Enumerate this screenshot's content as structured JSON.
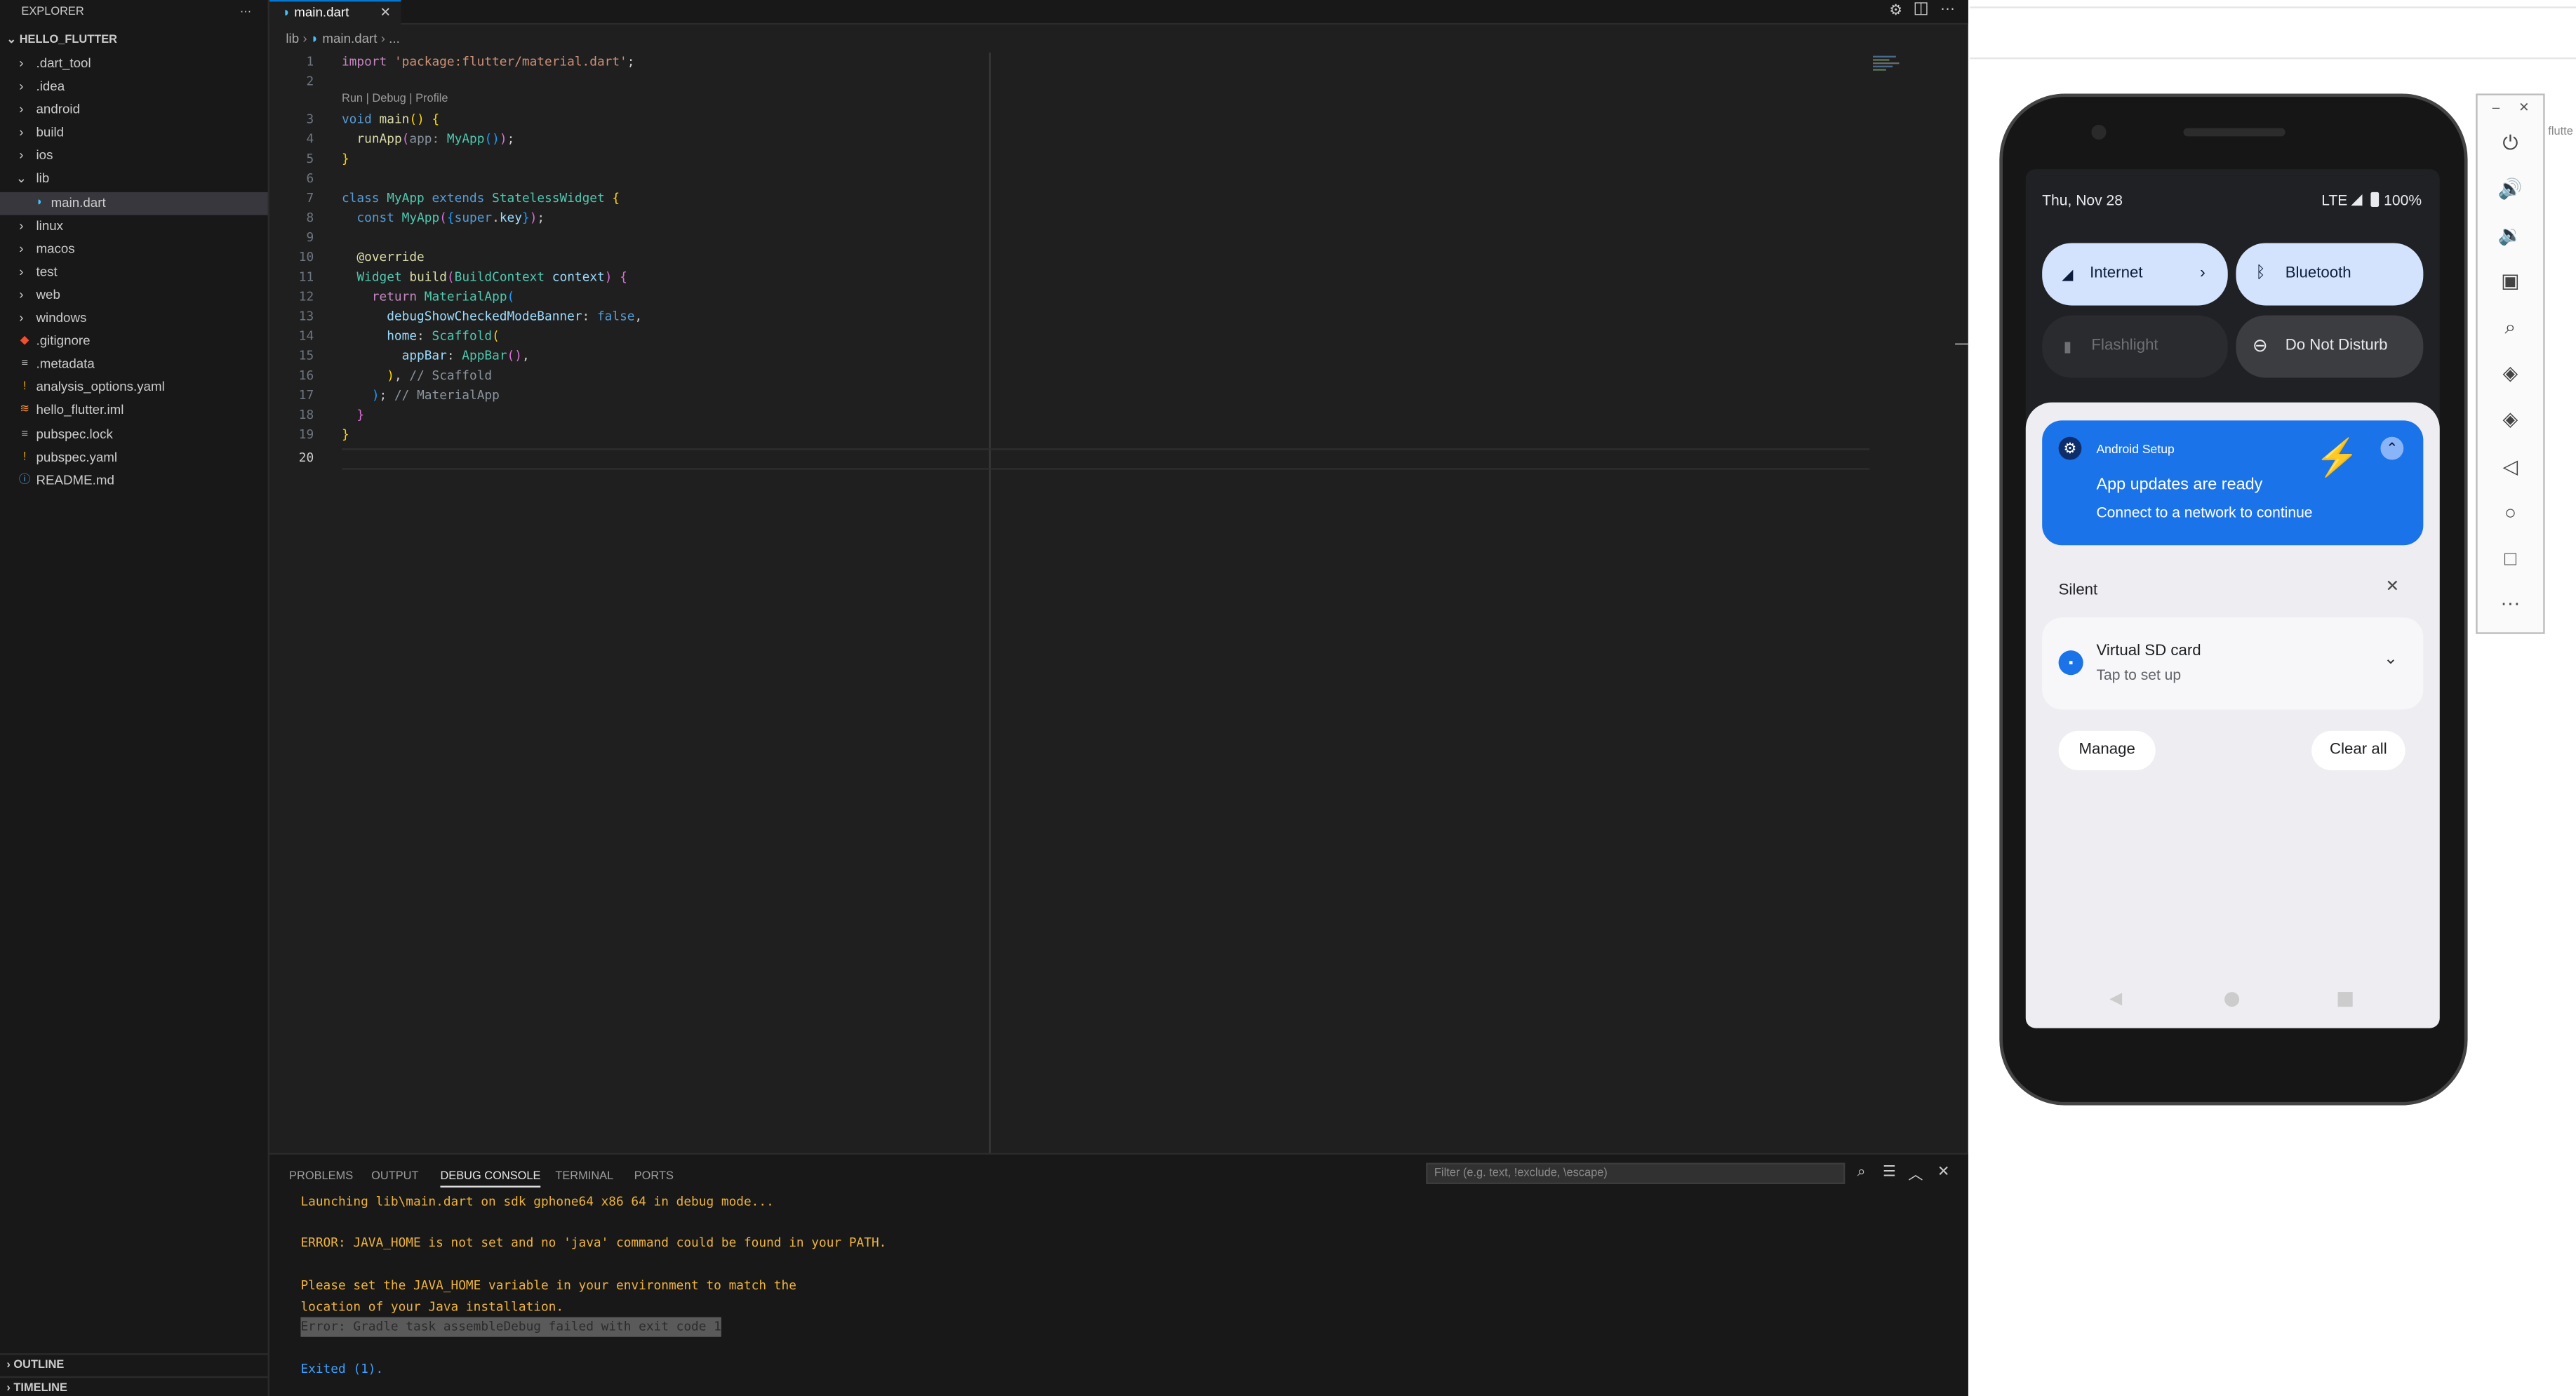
{
  "explorer": {
    "title": "EXPLORER",
    "project": "HELLO_FLUTTER",
    "more": "···",
    "items": [
      {
        "label": ".dart_tool",
        "kind": "folder",
        "open": false,
        "depth": 0
      },
      {
        "label": ".idea",
        "kind": "folder",
        "open": false,
        "depth": 0
      },
      {
        "label": "android",
        "kind": "folder",
        "open": false,
        "depth": 0
      },
      {
        "label": "build",
        "kind": "folder",
        "open": false,
        "depth": 0
      },
      {
        "label": "ios",
        "kind": "folder",
        "open": false,
        "depth": 0
      },
      {
        "label": "lib",
        "kind": "folder",
        "open": true,
        "depth": 0
      },
      {
        "label": "main.dart",
        "kind": "dart",
        "depth": 1,
        "selected": true
      },
      {
        "label": "linux",
        "kind": "folder",
        "open": false,
        "depth": 0
      },
      {
        "label": "macos",
        "kind": "folder",
        "open": false,
        "depth": 0
      },
      {
        "label": "test",
        "kind": "folder",
        "open": false,
        "depth": 0
      },
      {
        "label": "web",
        "kind": "folder",
        "open": false,
        "depth": 0
      },
      {
        "label": "windows",
        "kind": "folder",
        "open": false,
        "depth": 0
      },
      {
        "label": ".gitignore",
        "kind": "git",
        "depth": 0
      },
      {
        "label": ".metadata",
        "kind": "lines",
        "depth": 0
      },
      {
        "label": "analysis_options.yaml",
        "kind": "yaml",
        "depth": 0
      },
      {
        "label": "hello_flutter.iml",
        "kind": "rss",
        "depth": 0
      },
      {
        "label": "pubspec.lock",
        "kind": "lines",
        "depth": 0
      },
      {
        "label": "pubspec.yaml",
        "kind": "yaml",
        "depth": 0
      },
      {
        "label": "README.md",
        "kind": "info",
        "depth": 0
      }
    ],
    "outline": "OUTLINE",
    "timeline": "TIMELINE"
  },
  "editor": {
    "tab": "main.dart",
    "breadcrumb_folder": "lib",
    "breadcrumb_file": "main.dart",
    "breadcrumb_more": "...",
    "codelens": "Run | Debug | Profile"
  },
  "panel": {
    "tabs": [
      "PROBLEMS",
      "OUTPUT",
      "DEBUG CONSOLE",
      "TERMINAL",
      "PORTS"
    ],
    "active_tab": "DEBUG CONSOLE",
    "filter_placeholder": "Filter (e.g. text, !exclude, \\escape)",
    "lines": [
      "Launching lib\\main.dart on sdk gphone64 x86 64 in debug mode...",
      "ERROR: JAVA_HOME is not set and no 'java' command could be found in your PATH.",
      "Please set the JAVA_HOME variable in your environment to match the",
      "location of your Java installation.",
      "Error: Gradle task assembleDebug failed with exit code 1",
      "Exited (1)."
    ]
  },
  "phone": {
    "date": "Thu, Nov 28",
    "network": "LTE",
    "battery": "100%",
    "tiles": {
      "internet": "Internet",
      "bluetooth": "Bluetooth",
      "flashlight": "Flashlight",
      "dnd": "Do Not Disturb"
    },
    "notification": {
      "app": "Android Setup",
      "title": "App updates are ready",
      "text": "Connect to a network to continue"
    },
    "silent": "Silent",
    "sd": {
      "title": "Virtual SD card",
      "text": "Tap to set up"
    },
    "manage": "Manage",
    "clear_all": "Clear all"
  },
  "emulator": {
    "side_label": "flutte"
  }
}
